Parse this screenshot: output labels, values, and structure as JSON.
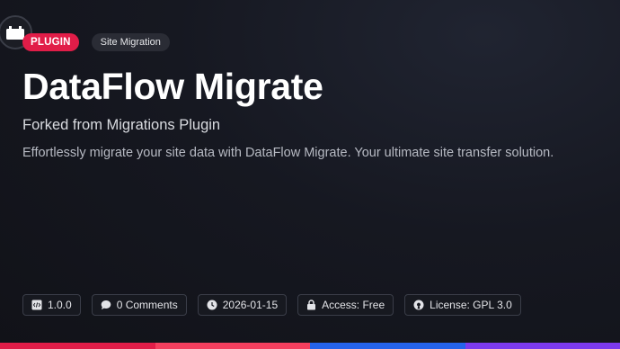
{
  "badges": {
    "type": "PLUGIN",
    "category": "Site Migration"
  },
  "title": "DataFlow Migrate",
  "subtitle": "Forked from Migrations Plugin",
  "description": "Effortlessly migrate your site data with DataFlow Migrate. Your ultimate site transfer solution.",
  "meta": {
    "version": "1.0.0",
    "comments": "0 Comments",
    "date": "2026-01-15",
    "access": "Access: Free",
    "license": "License: GPL 3.0"
  },
  "icons": {
    "logo": "plugin-icon",
    "version": "code-file-icon",
    "comments": "speech-bubble-icon",
    "date": "clock-icon",
    "access": "lock-icon",
    "license": "open-source-icon"
  },
  "colors": {
    "background": "#121319",
    "plugin_badge": "#e11d48",
    "accent_bars": [
      "#e11d48",
      "#f43f5e",
      "#2563eb",
      "#7c3aed"
    ]
  }
}
